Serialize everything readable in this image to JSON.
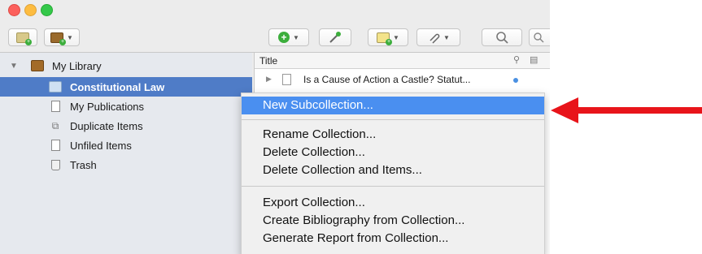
{
  "sidebar": {
    "items": [
      {
        "label": "My Library"
      },
      {
        "label": "Constitutional Law"
      },
      {
        "label": "My Publications"
      },
      {
        "label": "Duplicate Items"
      },
      {
        "label": "Unfiled Items"
      },
      {
        "label": "Trash"
      }
    ]
  },
  "items_pane": {
    "column_title": "Title",
    "rows": [
      {
        "title": "Is a Cause of Action a Castle? Statut..."
      }
    ]
  },
  "context_menu": {
    "items": [
      "New Subcollection...",
      "Rename Collection...",
      "Delete Collection...",
      "Delete Collection and Items...",
      "Export Collection...",
      "Create Bibliography from Collection...",
      "Generate Report from Collection..."
    ]
  },
  "colors": {
    "selection": "#4f7cc7",
    "menu_highlight": "#4a8ff0",
    "annotation_arrow": "#e8141a"
  },
  "icons": [
    "new-collection-icon",
    "new-library-icon",
    "new-item-icon",
    "magic-wand-icon",
    "new-note-icon",
    "attachment-icon",
    "search-icon"
  ]
}
